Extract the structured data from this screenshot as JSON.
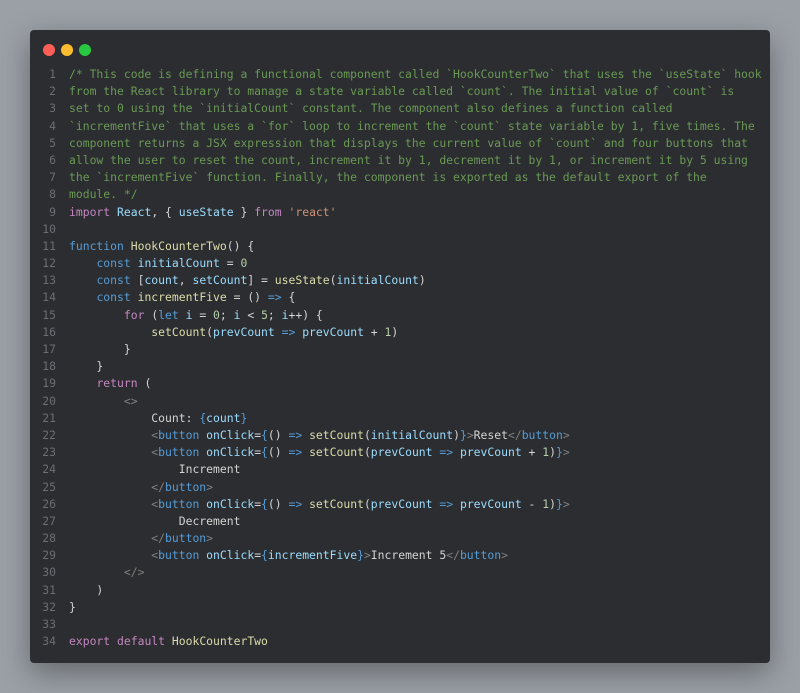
{
  "window": {
    "controls": [
      "close",
      "minimize",
      "maximize"
    ],
    "colors": {
      "close": "#ff5f57",
      "minimize": "#febc2e",
      "maximize": "#28c840",
      "background": "#2b2d30"
    }
  },
  "code_lines": [
    [
      {
        "t": "comment",
        "s": "/* This code is defining a functional component called `HookCounterTwo` that uses the `useState` hook"
      }
    ],
    [
      {
        "t": "comment",
        "s": "from the React library to manage a state variable called `count`. The initial value of `count` is"
      }
    ],
    [
      {
        "t": "comment",
        "s": "set to 0 using the `initialCount` constant. The component also defines a function called"
      }
    ],
    [
      {
        "t": "comment",
        "s": "`incrementFive` that uses a `for` loop to increment the `count` state variable by 1, five times. The"
      }
    ],
    [
      {
        "t": "comment",
        "s": "component returns a JSX expression that displays the current value of `count` and four buttons that"
      }
    ],
    [
      {
        "t": "comment",
        "s": "allow the user to reset the count, increment it by 1, decrement it by 1, or increment it by 5 using"
      }
    ],
    [
      {
        "t": "comment",
        "s": "the `incrementFive` function. Finally, the component is exported as the default export of the"
      }
    ],
    [
      {
        "t": "comment",
        "s": "module. */"
      }
    ],
    [
      {
        "t": "ctrl",
        "s": "import "
      },
      {
        "t": "var",
        "s": "React"
      },
      {
        "t": "text",
        "s": ", { "
      },
      {
        "t": "var",
        "s": "useState"
      },
      {
        "t": "text",
        "s": " } "
      },
      {
        "t": "ctrl",
        "s": "from "
      },
      {
        "t": "str",
        "s": "'react'"
      }
    ],
    [],
    [
      {
        "t": "keyword",
        "s": "function "
      },
      {
        "t": "fn",
        "s": "HookCounterTwo"
      },
      {
        "t": "text",
        "s": "() {"
      }
    ],
    [
      {
        "t": "text",
        "s": "    "
      },
      {
        "t": "keyword",
        "s": "const "
      },
      {
        "t": "var",
        "s": "initialCount"
      },
      {
        "t": "text",
        "s": " = "
      },
      {
        "t": "num",
        "s": "0"
      }
    ],
    [
      {
        "t": "text",
        "s": "    "
      },
      {
        "t": "keyword",
        "s": "const "
      },
      {
        "t": "text",
        "s": "["
      },
      {
        "t": "var",
        "s": "count"
      },
      {
        "t": "text",
        "s": ", "
      },
      {
        "t": "var",
        "s": "setCount"
      },
      {
        "t": "text",
        "s": "] = "
      },
      {
        "t": "fn",
        "s": "useState"
      },
      {
        "t": "text",
        "s": "("
      },
      {
        "t": "var",
        "s": "initialCount"
      },
      {
        "t": "text",
        "s": ")"
      }
    ],
    [
      {
        "t": "text",
        "s": "    "
      },
      {
        "t": "keyword",
        "s": "const "
      },
      {
        "t": "fn",
        "s": "incrementFive"
      },
      {
        "t": "text",
        "s": " = () "
      },
      {
        "t": "keyword",
        "s": "=>"
      },
      {
        "t": "text",
        "s": " {"
      }
    ],
    [
      {
        "t": "text",
        "s": "        "
      },
      {
        "t": "ctrl",
        "s": "for "
      },
      {
        "t": "text",
        "s": "("
      },
      {
        "t": "keyword",
        "s": "let "
      },
      {
        "t": "var",
        "s": "i"
      },
      {
        "t": "text",
        "s": " = "
      },
      {
        "t": "num",
        "s": "0"
      },
      {
        "t": "text",
        "s": "; "
      },
      {
        "t": "var",
        "s": "i"
      },
      {
        "t": "text",
        "s": " < "
      },
      {
        "t": "num",
        "s": "5"
      },
      {
        "t": "text",
        "s": "; "
      },
      {
        "t": "var",
        "s": "i"
      },
      {
        "t": "text",
        "s": "++) {"
      }
    ],
    [
      {
        "t": "text",
        "s": "            "
      },
      {
        "t": "fn",
        "s": "setCount"
      },
      {
        "t": "text",
        "s": "("
      },
      {
        "t": "var",
        "s": "prevCount"
      },
      {
        "t": "text",
        "s": " "
      },
      {
        "t": "keyword",
        "s": "=>"
      },
      {
        "t": "text",
        "s": " "
      },
      {
        "t": "var",
        "s": "prevCount"
      },
      {
        "t": "text",
        "s": " + "
      },
      {
        "t": "num",
        "s": "1"
      },
      {
        "t": "text",
        "s": ")"
      }
    ],
    [
      {
        "t": "text",
        "s": "        }"
      }
    ],
    [
      {
        "t": "text",
        "s": "    }"
      }
    ],
    [
      {
        "t": "text",
        "s": "    "
      },
      {
        "t": "ctrl",
        "s": "return"
      },
      {
        "t": "text",
        "s": " ("
      }
    ],
    [
      {
        "t": "text",
        "s": "        "
      },
      {
        "t": "punc",
        "s": "<>"
      }
    ],
    [
      {
        "t": "text",
        "s": "            Count: "
      },
      {
        "t": "keyword",
        "s": "{"
      },
      {
        "t": "var",
        "s": "count"
      },
      {
        "t": "keyword",
        "s": "}"
      }
    ],
    [
      {
        "t": "text",
        "s": "            "
      },
      {
        "t": "punc",
        "s": "<"
      },
      {
        "t": "tag",
        "s": "button"
      },
      {
        "t": "text",
        "s": " "
      },
      {
        "t": "var",
        "s": "onClick"
      },
      {
        "t": "text",
        "s": "="
      },
      {
        "t": "keyword",
        "s": "{"
      },
      {
        "t": "text",
        "s": "() "
      },
      {
        "t": "keyword",
        "s": "=>"
      },
      {
        "t": "text",
        "s": " "
      },
      {
        "t": "fn",
        "s": "setCount"
      },
      {
        "t": "text",
        "s": "("
      },
      {
        "t": "var",
        "s": "initialCount"
      },
      {
        "t": "text",
        "s": ")"
      },
      {
        "t": "keyword",
        "s": "}"
      },
      {
        "t": "punc",
        "s": ">"
      },
      {
        "t": "text",
        "s": "Reset"
      },
      {
        "t": "punc",
        "s": "</"
      },
      {
        "t": "tag",
        "s": "button"
      },
      {
        "t": "punc",
        "s": ">"
      }
    ],
    [
      {
        "t": "text",
        "s": "            "
      },
      {
        "t": "punc",
        "s": "<"
      },
      {
        "t": "tag",
        "s": "button"
      },
      {
        "t": "text",
        "s": " "
      },
      {
        "t": "var",
        "s": "onClick"
      },
      {
        "t": "text",
        "s": "="
      },
      {
        "t": "keyword",
        "s": "{"
      },
      {
        "t": "text",
        "s": "() "
      },
      {
        "t": "keyword",
        "s": "=>"
      },
      {
        "t": "text",
        "s": " "
      },
      {
        "t": "fn",
        "s": "setCount"
      },
      {
        "t": "text",
        "s": "("
      },
      {
        "t": "var",
        "s": "prevCount"
      },
      {
        "t": "text",
        "s": " "
      },
      {
        "t": "keyword",
        "s": "=>"
      },
      {
        "t": "text",
        "s": " "
      },
      {
        "t": "var",
        "s": "prevCount"
      },
      {
        "t": "text",
        "s": " + "
      },
      {
        "t": "num",
        "s": "1"
      },
      {
        "t": "text",
        "s": ")"
      },
      {
        "t": "keyword",
        "s": "}"
      },
      {
        "t": "punc",
        "s": ">"
      }
    ],
    [
      {
        "t": "text",
        "s": "                Increment"
      }
    ],
    [
      {
        "t": "text",
        "s": "            "
      },
      {
        "t": "punc",
        "s": "</"
      },
      {
        "t": "tag",
        "s": "button"
      },
      {
        "t": "punc",
        "s": ">"
      }
    ],
    [
      {
        "t": "text",
        "s": "            "
      },
      {
        "t": "punc",
        "s": "<"
      },
      {
        "t": "tag",
        "s": "button"
      },
      {
        "t": "text",
        "s": " "
      },
      {
        "t": "var",
        "s": "onClick"
      },
      {
        "t": "text",
        "s": "="
      },
      {
        "t": "keyword",
        "s": "{"
      },
      {
        "t": "text",
        "s": "() "
      },
      {
        "t": "keyword",
        "s": "=>"
      },
      {
        "t": "text",
        "s": " "
      },
      {
        "t": "fn",
        "s": "setCount"
      },
      {
        "t": "text",
        "s": "("
      },
      {
        "t": "var",
        "s": "prevCount"
      },
      {
        "t": "text",
        "s": " "
      },
      {
        "t": "keyword",
        "s": "=>"
      },
      {
        "t": "text",
        "s": " "
      },
      {
        "t": "var",
        "s": "prevCount"
      },
      {
        "t": "text",
        "s": " - "
      },
      {
        "t": "num",
        "s": "1"
      },
      {
        "t": "text",
        "s": ")"
      },
      {
        "t": "keyword",
        "s": "}"
      },
      {
        "t": "punc",
        "s": ">"
      }
    ],
    [
      {
        "t": "text",
        "s": "                Decrement"
      }
    ],
    [
      {
        "t": "text",
        "s": "            "
      },
      {
        "t": "punc",
        "s": "</"
      },
      {
        "t": "tag",
        "s": "button"
      },
      {
        "t": "punc",
        "s": ">"
      }
    ],
    [
      {
        "t": "text",
        "s": "            "
      },
      {
        "t": "punc",
        "s": "<"
      },
      {
        "t": "tag",
        "s": "button"
      },
      {
        "t": "text",
        "s": " "
      },
      {
        "t": "var",
        "s": "onClick"
      },
      {
        "t": "text",
        "s": "="
      },
      {
        "t": "keyword",
        "s": "{"
      },
      {
        "t": "var",
        "s": "incrementFive"
      },
      {
        "t": "keyword",
        "s": "}"
      },
      {
        "t": "punc",
        "s": ">"
      },
      {
        "t": "text",
        "s": "Increment 5"
      },
      {
        "t": "punc",
        "s": "</"
      },
      {
        "t": "tag",
        "s": "button"
      },
      {
        "t": "punc",
        "s": ">"
      }
    ],
    [
      {
        "t": "text",
        "s": "        "
      },
      {
        "t": "punc",
        "s": "</>"
      }
    ],
    [
      {
        "t": "text",
        "s": "    )"
      }
    ],
    [
      {
        "t": "text",
        "s": "}"
      }
    ],
    [],
    [
      {
        "t": "ctrl",
        "s": "export "
      },
      {
        "t": "ctrl",
        "s": "default "
      },
      {
        "t": "fn",
        "s": "HookCounterTwo"
      }
    ]
  ]
}
